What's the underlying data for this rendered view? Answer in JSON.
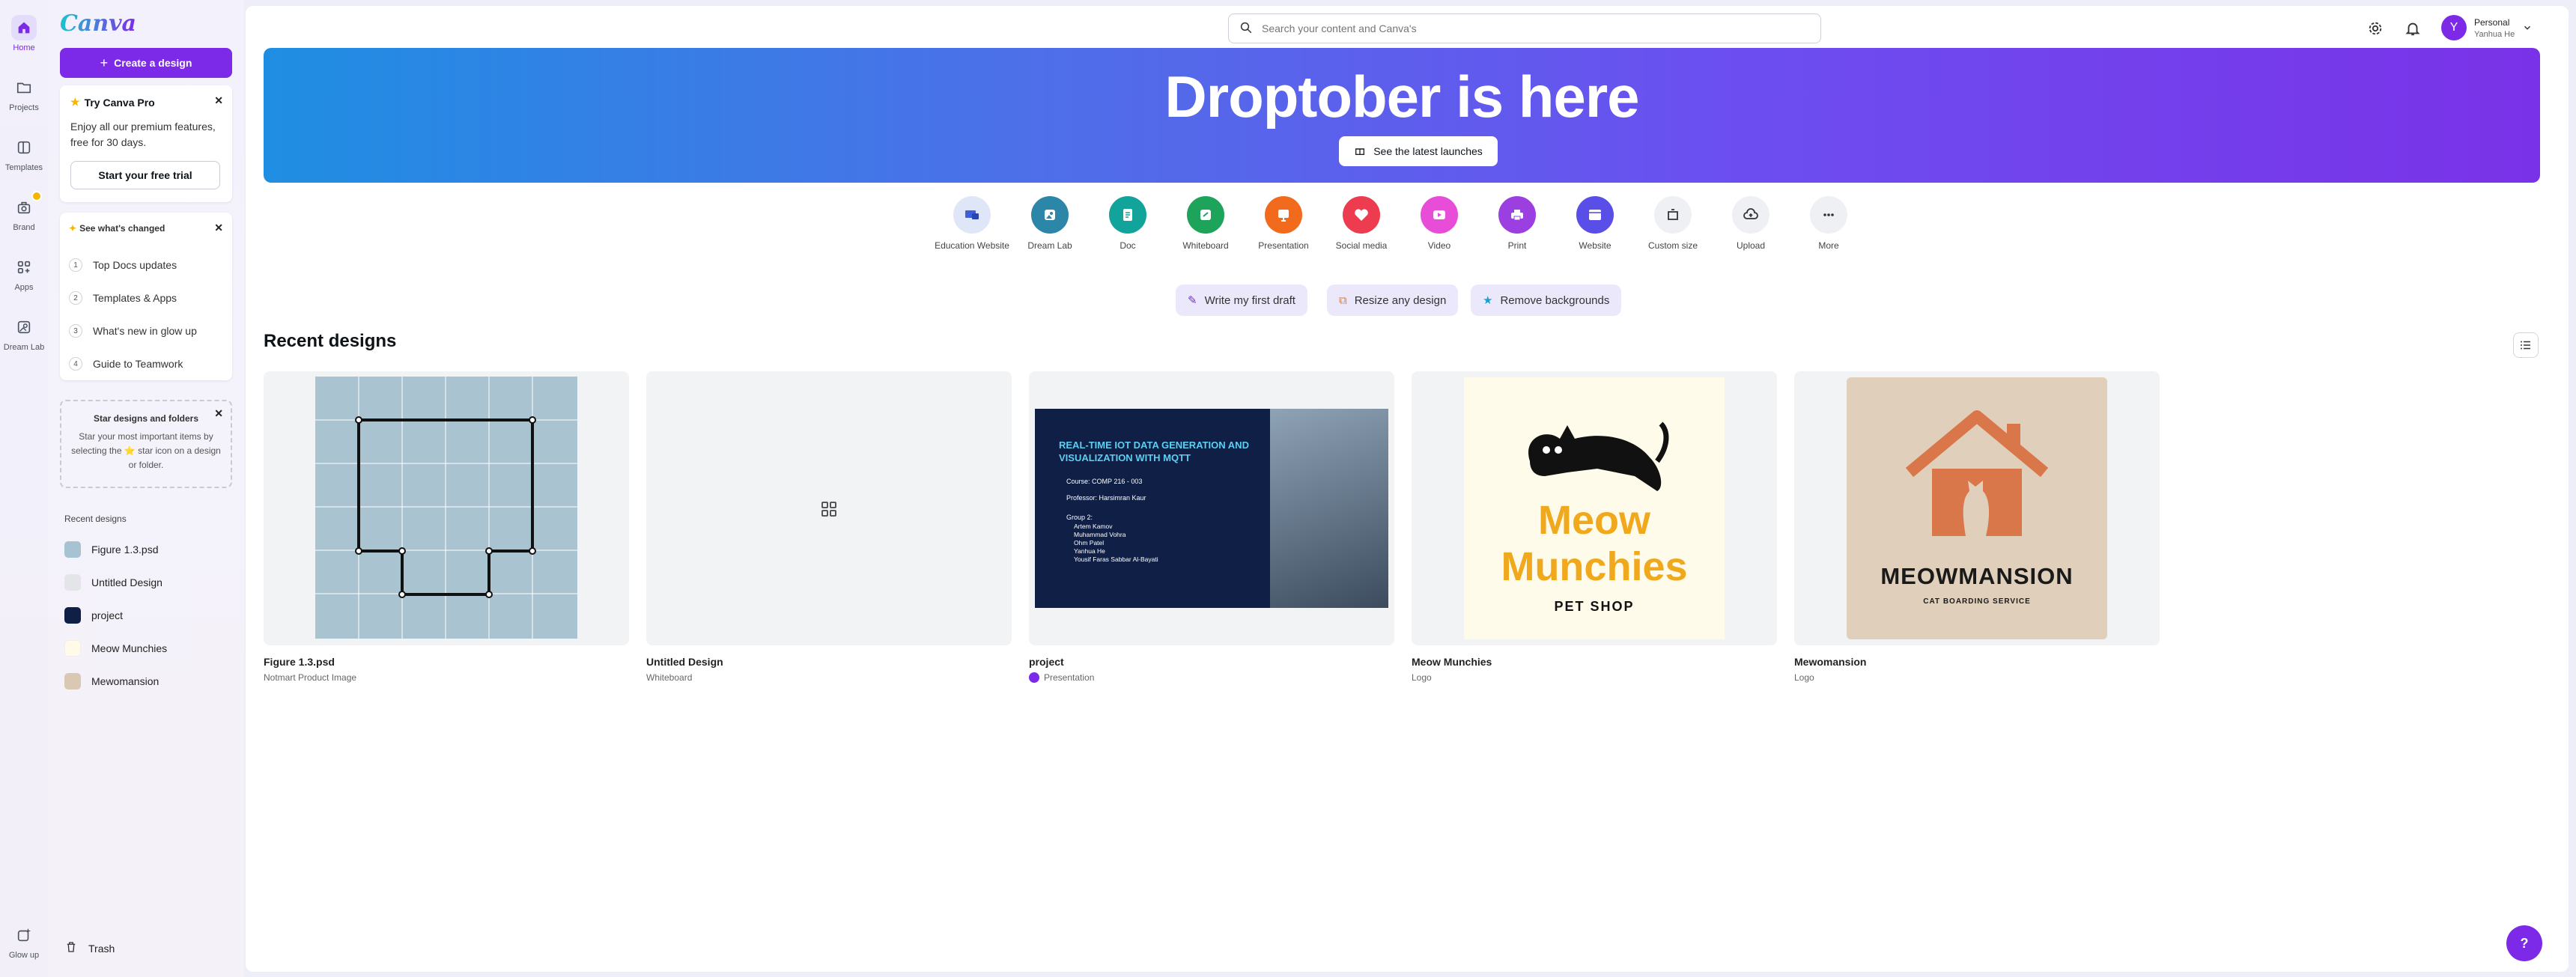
{
  "rail": {
    "items": [
      {
        "label": "Home"
      },
      {
        "label": "Projects"
      },
      {
        "label": "Templates"
      },
      {
        "label": "Brand"
      },
      {
        "label": "Apps"
      },
      {
        "label": "Dream Lab"
      }
    ],
    "glow_up": "Glow up"
  },
  "panel": {
    "logo": "Canva",
    "create_label": "Create a design",
    "pro": {
      "title": "Try Canva Pro",
      "text": "Enjoy all our premium features, free for 30 days.",
      "button": "Start your free trial"
    },
    "changed": {
      "title": "See what's changed",
      "items": [
        {
          "num": "1",
          "label": "Top Docs updates"
        },
        {
          "num": "2",
          "label": "Templates & Apps"
        },
        {
          "num": "3",
          "label": "What's new in glow up"
        },
        {
          "num": "4",
          "label": "Guide to Teamwork"
        }
      ]
    },
    "star": {
      "title": "Star designs and folders",
      "text": "Star your most important items by selecting the ⭐ star icon on a design or folder."
    },
    "recent_label": "Recent designs",
    "recent": [
      {
        "label": "Figure 1.3.psd"
      },
      {
        "label": "Untitled Design"
      },
      {
        "label": "project"
      },
      {
        "label": "Meow Munchies"
      },
      {
        "label": "Mewomansion"
      }
    ],
    "trash": "Trash"
  },
  "top": {
    "search_placeholder": "Search your content and Canva's",
    "account_name": "Personal",
    "account_user": "Yanhua He",
    "avatar_initial": "Y"
  },
  "banner": {
    "title": "Droptober is here",
    "button": "See the latest launches"
  },
  "categories": [
    {
      "label": "Education Website",
      "color": "#dfe6f7",
      "icon": "education-icon"
    },
    {
      "label": "Dream Lab",
      "color": "#2b86a8",
      "icon": "dream-lab-icon"
    },
    {
      "label": "Doc",
      "color": "#12a39a",
      "icon": "doc-icon"
    },
    {
      "label": "Whiteboard",
      "color": "#1ea35a",
      "icon": "whiteboard-icon"
    },
    {
      "label": "Presentation",
      "color": "#f26a1b",
      "icon": "presentation-icon"
    },
    {
      "label": "Social media",
      "color": "#ed3b4f",
      "icon": "heart-icon"
    },
    {
      "label": "Video",
      "color": "#e84dd8",
      "icon": "video-icon"
    },
    {
      "label": "Print",
      "color": "#9b3fe0",
      "icon": "print-icon"
    },
    {
      "label": "Website",
      "color": "#5a4ee8",
      "icon": "website-icon"
    },
    {
      "label": "Custom size",
      "color": "#eef0f3",
      "icon": "custom-size-icon"
    },
    {
      "label": "Upload",
      "color": "#eef0f3",
      "icon": "upload-icon"
    },
    {
      "label": "More",
      "color": "#eef0f3",
      "icon": "more-icon"
    }
  ],
  "chips": [
    {
      "label": "Write my first draft"
    },
    {
      "label": "Resize any design"
    },
    {
      "label": "Remove backgrounds"
    }
  ],
  "section_title": "Recent designs",
  "designs": [
    {
      "name": "Figure 1.3.psd",
      "type": "Notmart Product Image"
    },
    {
      "name": "Untitled Design",
      "type": "Whiteboard"
    },
    {
      "name": "project",
      "type": "Presentation",
      "slide": {
        "title": "REAL-TIME IOT DATA GENERATION AND VISUALIZATION WITH MQTT",
        "course": "Course: COMP 216 - 003",
        "prof": "Professor: Harsimran Kaur",
        "group": "Group 2:",
        "members": [
          "Artem Kamov",
          "Muhammad Vohra",
          "Ohm Patel",
          "Yanhua He",
          "Yousif Faras Sabbar Al-Bayati"
        ]
      }
    },
    {
      "name": "Meow Munchies",
      "type": "Logo",
      "logo_line1": "Meow",
      "logo_line2": "Munchies",
      "logo_sub": "PET SHOP"
    },
    {
      "name": "Mewomansion",
      "type": "Logo",
      "logo_title": "MEOWMANSION",
      "logo_sub": "CAT BOARDING SERVICE"
    }
  ],
  "help": "?"
}
